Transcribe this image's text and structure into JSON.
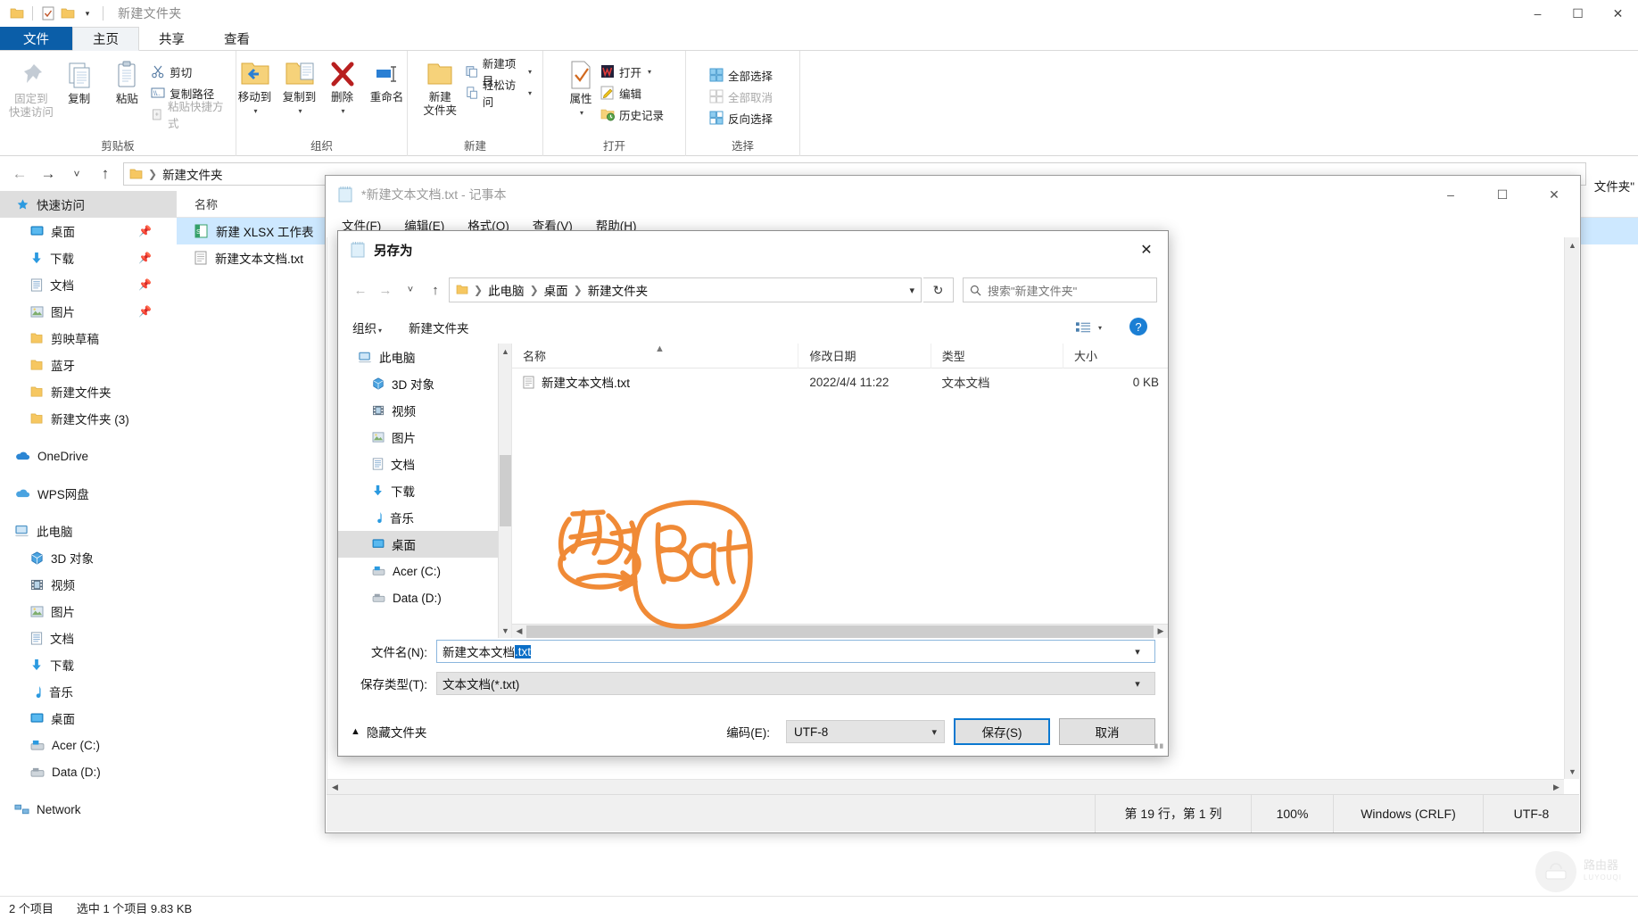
{
  "explorer": {
    "quick_access_title": "新建文件夹",
    "window_buttons": {
      "minimize": "–",
      "maximize": "☐",
      "close": "✕"
    },
    "tabs": [
      {
        "label": "文件",
        "kind": "file"
      },
      {
        "label": "主页",
        "kind": "active"
      },
      {
        "label": "共享",
        "kind": "normal"
      },
      {
        "label": "查看",
        "kind": "normal"
      }
    ],
    "ribbon_groups": [
      {
        "name": "剪贴板",
        "big": [
          {
            "label": "固定到\n快速访问",
            "icon": "pin-icon",
            "disabled": true
          },
          {
            "label": "复制",
            "icon": "copy-icon",
            "disabled": false
          },
          {
            "label": "粘贴",
            "icon": "paste-icon",
            "disabled": false
          }
        ],
        "small": [
          {
            "label": "剪切",
            "icon": "scissors-icon",
            "disabled": false
          },
          {
            "label": "复制路径",
            "icon": "copy-path-icon",
            "disabled": false
          },
          {
            "label": "粘贴快捷方式",
            "icon": "paste-shortcut-icon",
            "disabled": true
          }
        ]
      },
      {
        "name": "组织",
        "big": [
          {
            "label": "移动到",
            "icon": "move-to-icon",
            "caret": true
          },
          {
            "label": "复制到",
            "icon": "copy-to-icon",
            "caret": true
          },
          {
            "label": "删除",
            "icon": "delete-icon",
            "caret": true
          },
          {
            "label": "重命名",
            "icon": "rename-icon",
            "caret": false
          }
        ],
        "small": []
      },
      {
        "name": "新建",
        "big": [
          {
            "label": "新建\n文件夹",
            "icon": "new-folder-icon",
            "caret": false
          }
        ],
        "small": [
          {
            "label": "新建项目",
            "icon": "new-item-icon",
            "caret": true
          },
          {
            "label": "轻松访问",
            "icon": "easy-access-icon",
            "caret": true
          }
        ]
      },
      {
        "name": "打开",
        "big": [
          {
            "label": "属性",
            "icon": "properties-icon",
            "caret": true
          }
        ],
        "small": [
          {
            "label": "打开",
            "icon": "wps-open-icon",
            "caret": true
          },
          {
            "label": "编辑",
            "icon": "edit-icon",
            "caret": false
          },
          {
            "label": "历史记录",
            "icon": "history-icon",
            "caret": false
          }
        ]
      },
      {
        "name": "选择",
        "big": [],
        "small": [
          {
            "label": "全部选择",
            "icon": "select-all-icon",
            "disabled": false
          },
          {
            "label": "全部取消",
            "icon": "select-none-icon",
            "disabled": true
          },
          {
            "label": "反向选择",
            "icon": "invert-selection-icon",
            "disabled": false
          }
        ]
      }
    ],
    "address": {
      "back": "←",
      "forward": "→",
      "recent": "˅",
      "up": "↑",
      "crumbs": [
        "新建文件夹"
      ]
    },
    "nav_items": [
      {
        "label": "快速访问",
        "icon": "star-icon",
        "level": 0,
        "selected": true,
        "pinned": false
      },
      {
        "label": "桌面",
        "icon": "desktop-icon",
        "level": 1,
        "selected": false,
        "pinned": true
      },
      {
        "label": "下载",
        "icon": "download-icon",
        "level": 1,
        "selected": false,
        "pinned": true
      },
      {
        "label": "文档",
        "icon": "document-icon",
        "level": 1,
        "selected": false,
        "pinned": true
      },
      {
        "label": "图片",
        "icon": "pictures-icon",
        "level": 1,
        "selected": false,
        "pinned": true
      },
      {
        "label": "剪映草稿",
        "icon": "folder-icon",
        "level": 1,
        "selected": false,
        "pinned": false
      },
      {
        "label": "蓝牙",
        "icon": "folder-icon",
        "level": 1,
        "selected": false,
        "pinned": false
      },
      {
        "label": "新建文件夹",
        "icon": "folder-icon",
        "level": 1,
        "selected": false,
        "pinned": false
      },
      {
        "label": "新建文件夹 (3)",
        "icon": "folder-icon",
        "level": 1,
        "selected": false,
        "pinned": false
      },
      {
        "label": "__GAP__",
        "icon": "",
        "level": 0,
        "selected": false,
        "pinned": false
      },
      {
        "label": "OneDrive",
        "icon": "onedrive-icon",
        "level": 0,
        "selected": false,
        "pinned": false
      },
      {
        "label": "__GAP__",
        "icon": "",
        "level": 0,
        "selected": false,
        "pinned": false
      },
      {
        "label": "WPS网盘",
        "icon": "wps-cloud-icon",
        "level": 0,
        "selected": false,
        "pinned": false
      },
      {
        "label": "__GAP__",
        "icon": "",
        "level": 0,
        "selected": false,
        "pinned": false
      },
      {
        "label": "此电脑",
        "icon": "this-pc-icon",
        "level": 0,
        "selected": false,
        "pinned": false
      },
      {
        "label": "3D 对象",
        "icon": "3d-objects-icon",
        "level": 1,
        "selected": false,
        "pinned": false
      },
      {
        "label": "视频",
        "icon": "videos-icon",
        "level": 1,
        "selected": false,
        "pinned": false
      },
      {
        "label": "图片",
        "icon": "pictures-icon",
        "level": 1,
        "selected": false,
        "pinned": false
      },
      {
        "label": "文档",
        "icon": "document-icon",
        "level": 1,
        "selected": false,
        "pinned": false
      },
      {
        "label": "下载",
        "icon": "download-icon",
        "level": 1,
        "selected": false,
        "pinned": false
      },
      {
        "label": "音乐",
        "icon": "music-icon",
        "level": 1,
        "selected": false,
        "pinned": false
      },
      {
        "label": "桌面",
        "icon": "desktop-icon",
        "level": 1,
        "selected": false,
        "pinned": false
      },
      {
        "label": "Acer (C:)",
        "icon": "drive-icon",
        "level": 1,
        "selected": false,
        "pinned": false
      },
      {
        "label": "Data (D:)",
        "icon": "drive-icon",
        "level": 1,
        "selected": false,
        "pinned": false
      },
      {
        "label": "__GAP__",
        "icon": "",
        "level": 0,
        "selected": false,
        "pinned": false
      },
      {
        "label": "Network",
        "icon": "network-icon",
        "level": 0,
        "selected": false,
        "pinned": false
      }
    ],
    "list_header": "名称",
    "files": [
      {
        "name": "新建 XLSX 工作表",
        "icon": "excel-icon",
        "selected": true
      },
      {
        "name": "新建文本文档.txt",
        "icon": "text-file-icon",
        "selected": false
      }
    ],
    "status": {
      "count": "2 个项目",
      "selection": "选中 1 个项目  9.83 KB"
    },
    "right_label": "文件夹\""
  },
  "notepad": {
    "title": "*新建文本文档.txt - 记事本",
    "icon": "notepad-icon",
    "window_buttons": {
      "minimize": "–",
      "maximize": "☐",
      "close": "✕"
    },
    "menu": [
      "文件(F)",
      "编辑(E)",
      "格式(O)",
      "查看(V)",
      "帮助(H)"
    ],
    "status": {
      "position": "第 19 行，第 1 列",
      "zoom": "100%",
      "line_ending": "Windows (CRLF)",
      "encoding": "UTF-8"
    }
  },
  "save_as": {
    "title": "另存为",
    "icon": "notepad-icon",
    "close": "✕",
    "nav": {
      "back": "←",
      "forward": "→",
      "recent": "˅",
      "up": "↑",
      "refresh": "↻"
    },
    "breadcrumbs": [
      "此电脑",
      "桌面",
      "新建文件夹"
    ],
    "search_placeholder": "搜索\"新建文件夹\"",
    "toolbar": {
      "organize": "组织",
      "new_folder": "新建文件夹",
      "view_icon": "view-options-icon",
      "help_icon": "help-icon"
    },
    "tree": [
      {
        "label": "此电脑",
        "icon": "this-pc-icon",
        "level": 0,
        "selected": false
      },
      {
        "label": "3D 对象",
        "icon": "3d-objects-icon",
        "level": 1,
        "selected": false
      },
      {
        "label": "视频",
        "icon": "videos-icon",
        "level": 1,
        "selected": false
      },
      {
        "label": "图片",
        "icon": "pictures-icon",
        "level": 1,
        "selected": false
      },
      {
        "label": "文档",
        "icon": "document-icon",
        "level": 1,
        "selected": false
      },
      {
        "label": "下载",
        "icon": "download-icon",
        "level": 1,
        "selected": false
      },
      {
        "label": "音乐",
        "icon": "music-icon",
        "level": 1,
        "selected": false
      },
      {
        "label": "桌面",
        "icon": "desktop-icon",
        "level": 1,
        "selected": true
      },
      {
        "label": "Acer (C:)",
        "icon": "drive-icon",
        "level": 1,
        "selected": false
      },
      {
        "label": "Data (D:)",
        "icon": "drive-icon",
        "level": 1,
        "selected": false
      }
    ],
    "columns": [
      "名称",
      "修改日期",
      "类型",
      "大小"
    ],
    "rows": [
      {
        "name": "新建文本文档.txt",
        "icon": "text-file-icon",
        "modified": "2022/4/4 11:22",
        "type": "文本文档",
        "size": "0 KB"
      }
    ],
    "filename": {
      "label": "文件名(N):",
      "value_base": "新建文本文档",
      "value_selected": ".txt"
    },
    "filetype": {
      "label": "保存类型(T):",
      "value": "文本文档(*.txt)"
    },
    "hide_folders": "隐藏文件夹",
    "encoding": {
      "label": "编码(E):",
      "value": "UTF-8"
    },
    "save_button": "保存(S)",
    "cancel_button": "取消"
  },
  "annotation": {
    "color": "#f08a36",
    "strokes": "hand-drawn 改 -> bat circled"
  },
  "watermark": {
    "line1": "路由器",
    "line2": "LUYOUQI"
  }
}
